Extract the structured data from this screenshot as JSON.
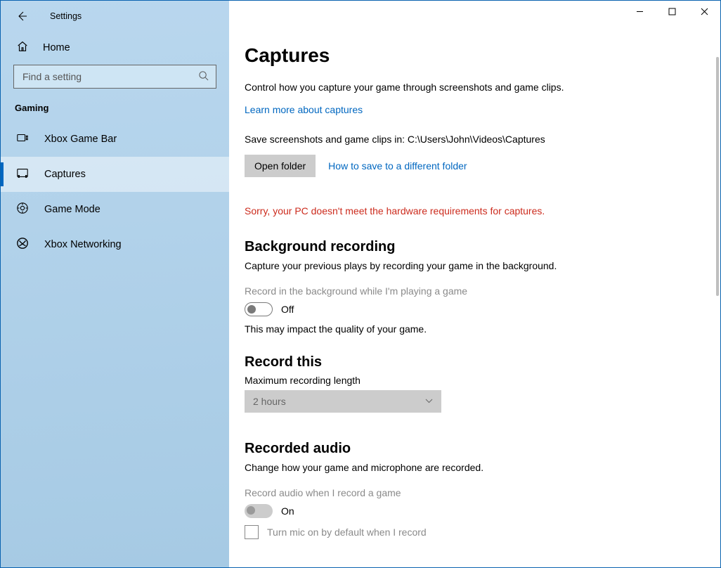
{
  "app_title": "Settings",
  "sidebar": {
    "home_label": "Home",
    "search_placeholder": "Find a setting",
    "category_label": "Gaming",
    "items": [
      {
        "label": "Xbox Game Bar"
      },
      {
        "label": "Captures"
      },
      {
        "label": "Game Mode"
      },
      {
        "label": "Xbox Networking"
      }
    ]
  },
  "page": {
    "title": "Captures",
    "intro": "Control how you capture your game through screenshots and game clips.",
    "learn_more": "Learn more about captures",
    "save_line_prefix": "Save screenshots and game clips in: ",
    "save_path": "C:\\Users\\John\\Videos\\Captures",
    "open_folder_btn": "Open folder",
    "howto_link": "How to save to a different folder",
    "error": "Sorry, your PC doesn't meet the hardware requirements for captures.",
    "bg_recording": {
      "title": "Background recording",
      "desc": "Capture your previous plays by recording your game in the background.",
      "toggle_label": "Record in the background while I'm playing a game",
      "toggle_state": "Off",
      "impact_note": "This may impact the quality of your game."
    },
    "record_this": {
      "title": "Record this",
      "sub_label": "Maximum recording length",
      "value": "2 hours"
    },
    "recorded_audio": {
      "title": "Recorded audio",
      "desc": "Change how your game and microphone are recorded.",
      "toggle_label": "Record audio when I record a game",
      "toggle_state": "On",
      "checkbox_label": "Turn mic on by default when I record"
    }
  }
}
